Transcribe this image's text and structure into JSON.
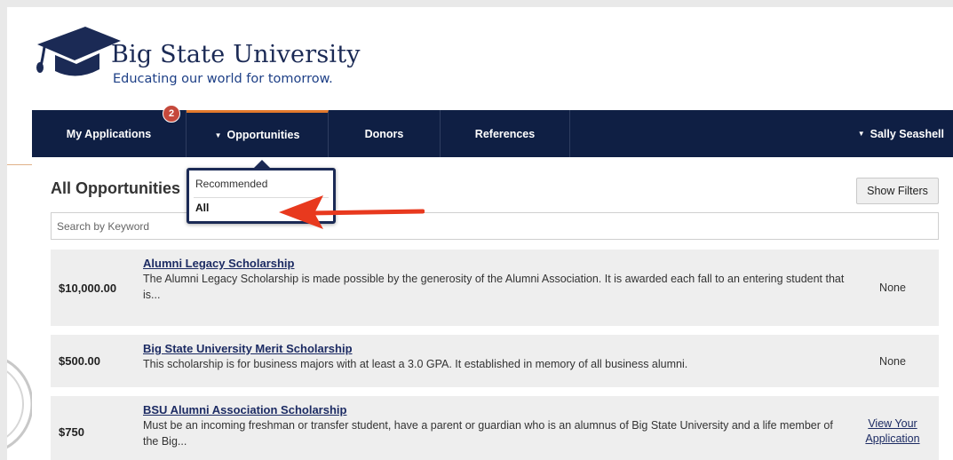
{
  "header": {
    "title": "Big State University",
    "tagline": "Educating our world for tomorrow."
  },
  "nav": {
    "tabs": [
      {
        "label": "My Applications",
        "badge": "2"
      },
      {
        "label": "Opportunities",
        "active": true
      },
      {
        "label": "Donors"
      },
      {
        "label": "References"
      }
    ],
    "user": "Sally Seashell"
  },
  "dropdown": {
    "items": [
      "Recommended",
      "All"
    ]
  },
  "main": {
    "title": "All Opportunities",
    "show_filters": "Show Filters",
    "search_placeholder": "Search by Keyword",
    "rows": [
      {
        "amount": "$10,000.00",
        "name": "Alumni Legacy Scholarship",
        "description": "The Alumni Legacy Scholarship is made possible by the generosity of the Alumni Association. It is awarded each fall to an entering student that is...",
        "status": "None"
      },
      {
        "amount": "$500.00",
        "name": "Big State University Merit Scholarship",
        "description": "This scholarship is for business majors with at least a 3.0 GPA. It established in memory of all business alumni.",
        "status": "None"
      },
      {
        "amount": "$750",
        "name": "BSU Alumni Association Scholarship",
        "description": "Must be an incoming freshman or transfer student, have a parent or guardian who is an alumnus of Big State University and a life member of the Big...",
        "status": "View Your Application"
      }
    ]
  },
  "colors": {
    "nav_bg": "#0f1f44",
    "accent": "#e2792d",
    "badge": "#c5493c",
    "link": "#1c2b63",
    "annotation_arrow": "#e8391e"
  }
}
